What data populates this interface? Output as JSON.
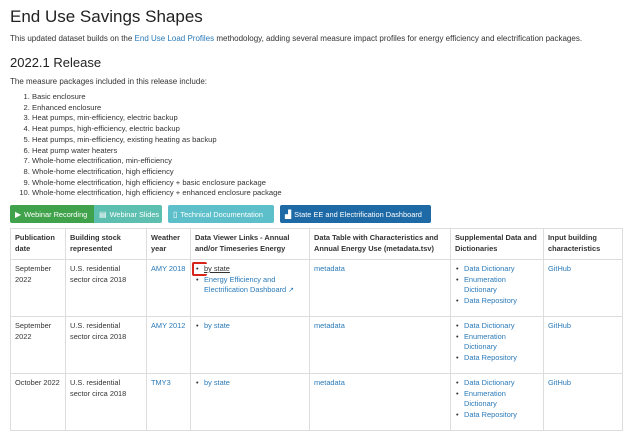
{
  "page_title": "End Use Savings Shapes",
  "intro": {
    "before": "This updated dataset builds on the ",
    "link": "End Use Load Profiles",
    "after": " methodology, adding several measure impact profiles for energy efficiency and electrification packages."
  },
  "release_title": "2022.1 Release",
  "release_intro": "The measure packages included in this release include:",
  "packages": [
    "Basic enclosure",
    "Enhanced enclosure",
    "Heat pumps, min-efficiency, electric backup",
    "Heat pumps, high-efficiency, electric backup",
    "Heat pumps, min-efficiency, existing heating as backup",
    "Heat pump water heaters",
    "Whole-home electrification, min-efficiency",
    "Whole-home electrification, high efficiency",
    "Whole-home electrification, high efficiency + basic enclosure package",
    "Whole-home electrification, high efficiency + enhanced enclosure package"
  ],
  "buttons": {
    "webinar_recording": "Webinar Recording",
    "webinar_slides": "Webinar Slides",
    "tech_docs": "Technical Documentation",
    "dashboard": "State EE and Electrification Dashboard"
  },
  "icons": {
    "webinar_recording": "play-icon",
    "webinar_slides": "slides-icon",
    "tech_docs": "document-icon",
    "dashboard": "chart-icon",
    "external_link": "external-link-icon"
  },
  "colors": {
    "link": "#2a7ab8",
    "green_button": "#40a34b",
    "teal_button": "#5cbfb0",
    "blue_button": "#1e6aa6",
    "highlight": "#d9241c"
  },
  "table": {
    "headers": [
      "Publication date",
      "Building stock represented",
      "Weather year",
      "Data Viewer Links - Annual and/or Timeseries Energy",
      "Data Table with Characteristics and Annual Energy Use (metadata.tsv)",
      "Supplemental Data and Dictionaries",
      "Input building characteristics"
    ],
    "rows": [
      {
        "date": "September 2022",
        "stock": "U.S. residential sector circa 2018",
        "weather": "AMY 2018",
        "viewer_1": "by state",
        "viewer_2": "Energy Efficiency and Electrification Dashboard",
        "metadata": "metadata",
        "supp": [
          "Data Dictionary",
          "Enumeration Dictionary",
          "Data Repository"
        ],
        "input": "GitHub"
      },
      {
        "date": "September 2022",
        "stock": "U.S. residential sector circa 2018",
        "weather": "AMY 2012",
        "viewer_1": "by state",
        "metadata": "metadata",
        "supp": [
          "Data Dictionary",
          "Enumeration Dictionary",
          "Data Repository"
        ],
        "input": "GitHub"
      },
      {
        "date": "October 2022",
        "stock": "U.S. residential sector circa 2018",
        "weather": "TMY3",
        "viewer_1": "by state",
        "metadata": "metadata",
        "supp": [
          "Data Dictionary",
          "Enumeration Dictionary",
          "Data Repository"
        ],
        "input": "GitHub"
      }
    ]
  }
}
